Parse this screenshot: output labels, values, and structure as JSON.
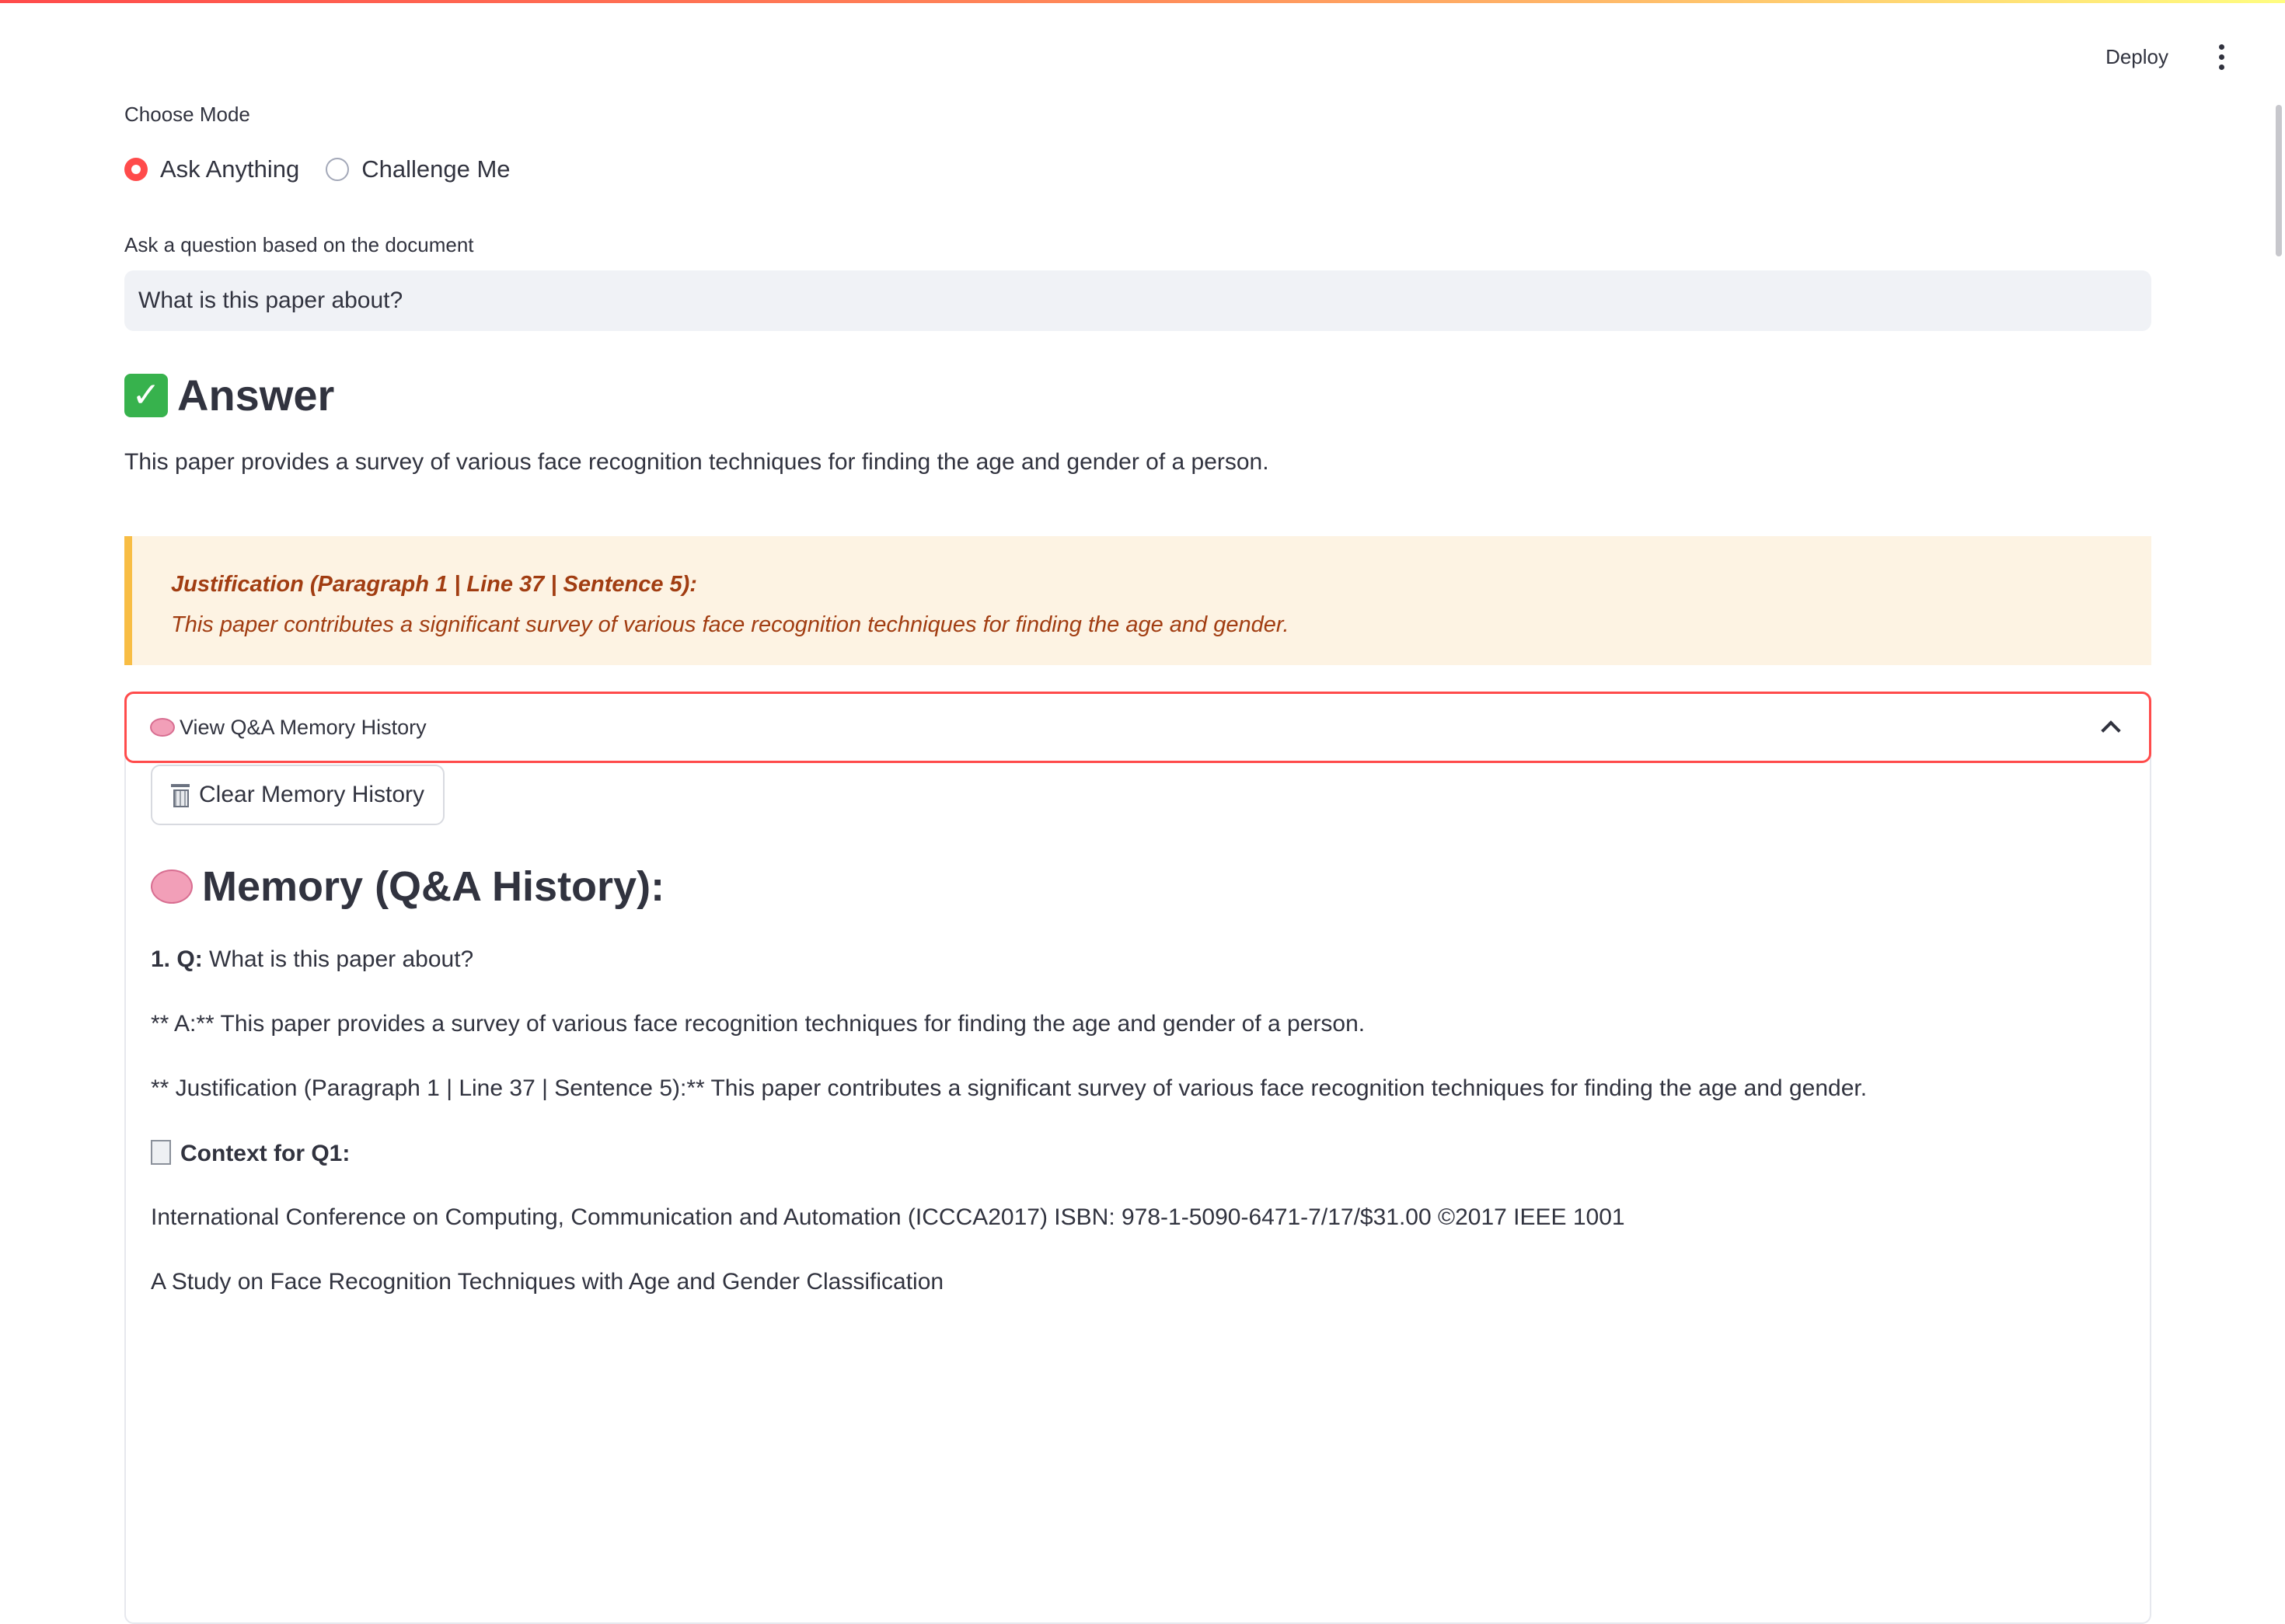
{
  "toolbar": {
    "deploy_label": "Deploy",
    "menu_icon": "kebab-menu-icon"
  },
  "mode": {
    "label": "Choose Mode",
    "options": [
      {
        "label": "Ask Anything",
        "selected": true
      },
      {
        "label": "Challenge Me",
        "selected": false
      }
    ]
  },
  "question": {
    "label": "Ask a question based on the document",
    "value": "What is this paper about?"
  },
  "answer": {
    "heading": "Answer",
    "heading_icon": "check-mark-icon",
    "text": "This paper provides a survey of various face recognition techniques for finding the age and gender of a person."
  },
  "justification": {
    "title": "Justification (Paragraph 1 | Line 37 | Sentence 5):",
    "text": "This paper contributes a significant survey of various face recognition techniques for finding the age and gender."
  },
  "memory_expander": {
    "title": "View Q&A Memory History",
    "clear_label": "Clear Memory History",
    "heading": "Memory (Q&A History):",
    "q_prefix": "1. Q:",
    "q_text": " What is this paper about?",
    "a_line": "** A:** This paper provides a survey of various face recognition techniques for finding the age and gender of a person.",
    "j_line": "** Justification (Paragraph 1 | Line 37 | Sentence 5):** This paper contributes a significant survey of various face recognition techniques for finding the age and gender.",
    "context_label": "Context for Q1:",
    "context_lines": [
      "International Conference on Computing, Communication and Automation (ICCCA2017) ISBN: 978-1-5090-6471-7/17/$31.00 ©2017 IEEE 1001",
      "A Study on Face Recognition Techniques with Age and Gender Classification"
    ]
  },
  "colors": {
    "accent": "#ff4b4b",
    "input_bg": "#f0f2f6",
    "justification_bg": "#fdf3e3",
    "justification_border": "#f8bd44",
    "justification_text": "#a13d12",
    "text": "#31333f"
  }
}
